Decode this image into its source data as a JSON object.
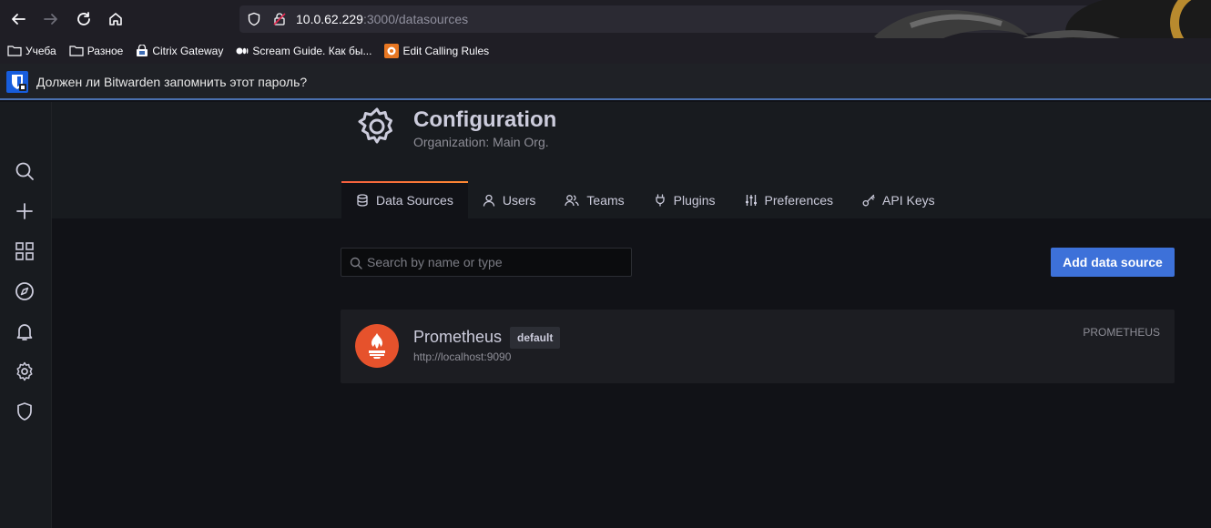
{
  "browser": {
    "url_host": "10.0.62.229",
    "url_path": ":3000/datasources",
    "bookmarks": [
      "Учеба",
      "Разное",
      "Citrix Gateway",
      "Scream Guide. Как бы...",
      "Edit Calling Rules"
    ]
  },
  "bitwarden": {
    "prompt": "Должен ли Bitwarden запомнить этот пароль?"
  },
  "sidebar": {
    "icons": [
      "search-icon",
      "plus-icon",
      "dashboards-icon",
      "explore-icon",
      "alerting-icon",
      "configuration-icon",
      "server-admin-icon"
    ]
  },
  "header": {
    "title": "Configuration",
    "subtitle": "Organization: Main Org.",
    "tabs": [
      {
        "label": "Data Sources",
        "icon": "database-icon",
        "active": true
      },
      {
        "label": "Users",
        "icon": "user-icon"
      },
      {
        "label": "Teams",
        "icon": "users-icon"
      },
      {
        "label": "Plugins",
        "icon": "plug-icon"
      },
      {
        "label": "Preferences",
        "icon": "sliders-icon"
      },
      {
        "label": "API Keys",
        "icon": "key-icon"
      }
    ]
  },
  "search": {
    "placeholder": "Search by name or type",
    "value": ""
  },
  "actions": {
    "add_label": "Add data source"
  },
  "datasources": [
    {
      "name": "Prometheus",
      "badge": "default",
      "url": "http://localhost:9090",
      "type": "PROMETHEUS"
    }
  ],
  "colors": {
    "accent": "#3d71d9",
    "tab_active_gradient": [
      "#f55f3e",
      "#ff8833"
    ],
    "prometheus": "#e6522c"
  }
}
